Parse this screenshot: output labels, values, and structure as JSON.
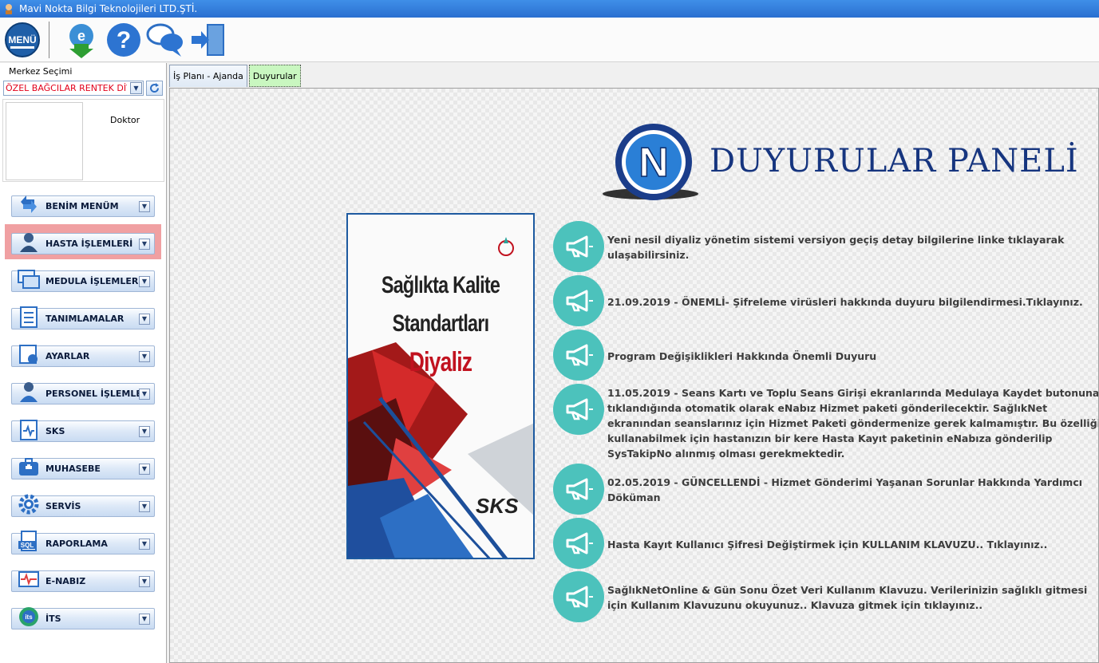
{
  "app": {
    "title": "Mavi Nokta Bilgi Teknolojileri LTD.ŞTİ."
  },
  "toolbar": {
    "menu_label": "MENÜ",
    "buttons": [
      {
        "name": "update-icon"
      },
      {
        "name": "help-icon"
      },
      {
        "name": "chat-icon"
      },
      {
        "name": "exit-icon"
      }
    ]
  },
  "sidebar": {
    "merkez_label": "Merkez Seçimi",
    "merkez_value": "ÖZEL BAĞCILAR RENTEK DİYALİZ",
    "doctor_label": "Doktor",
    "items": [
      {
        "label": "BENİM MENÜM",
        "icon": "arrows-icon"
      },
      {
        "label": "HASTA İŞLEMLERİ",
        "icon": "patient-icon"
      },
      {
        "label": "MEDULA İŞLEMLERİ",
        "icon": "windows-icon"
      },
      {
        "label": "TANIMLAMALAR",
        "icon": "checklist-icon"
      },
      {
        "label": "AYARLAR",
        "icon": "settings-calendar-icon"
      },
      {
        "label": "PERSONEL İŞLEMLERİ",
        "icon": "staff-icon"
      },
      {
        "label": "SKS",
        "icon": "clipboard-pulse-icon"
      },
      {
        "label": "MUHASEBE",
        "icon": "medical-bag-icon"
      },
      {
        "label": "SERVİS",
        "icon": "gear-icon"
      },
      {
        "label": "RAPORLAMA",
        "icon": "sql-report-icon"
      },
      {
        "label": "E-NABIZ",
        "icon": "heartbeat-icon"
      },
      {
        "label": "İTS",
        "icon": "its-icon"
      }
    ],
    "highlight_color": "#f0a0a2"
  },
  "tabs": [
    {
      "label": "İş Planı - Ajanda",
      "active": false
    },
    {
      "label": "Duyurular",
      "active": true
    }
  ],
  "content": {
    "panel_title": "DUYURULAR PANELİ",
    "logo_letter": "N",
    "book": {
      "line1": "Sağlıkta Kalite",
      "line2": "Standartları",
      "line3": "Diyaliz",
      "badge": "SKS"
    },
    "announcements": [
      "Yeni nesil diyaliz yönetim sistemi versiyon geçiş detay bilgilerine linke tıklayarak ulaşabilirsiniz.",
      "21.09.2019 - ÖNEMLİ- Şifreleme virüsleri hakkında duyuru bilgilendirmesi.Tıklayınız.",
      "Program Değişiklikleri Hakkında Önemli Duyuru",
      "11.05.2019 - Seans Kartı ve Toplu Seans Girişi ekranlarında Medulaya Kaydet butonuna tıklandığında otomatik olarak eNabız Hizmet paketi gönderilecektir. SağlıkNet ekranından seanslarınız için Hizmet Paketi göndermenize gerek kalmamıştır. Bu özelliği kullanabilmek için hastanızın bir kere Hasta Kayıt paketinin eNabıza gönderilip SysTakipNo alınmış olması gerekmektedir.",
      "02.05.2019 - GÜNCELLENDİ - Hizmet Gönderimi Yaşanan Sorunlar Hakkında Yardımcı Döküman",
      "Hasta Kayıt Kullanıcı Şifresi Değiştirmek için KULLANIM KLAVUZU.. Tıklayınız..",
      "SağlıkNetOnline & Gün Sonu Özet Veri Kullanım Klavuzu. Verilerinizin sağlıklı gitmesi için Kullanım Klavuzunu okuyunuz.. Klavuza gitmek için tıklayınız.."
    ],
    "accent_color": "#4cc2bc"
  }
}
